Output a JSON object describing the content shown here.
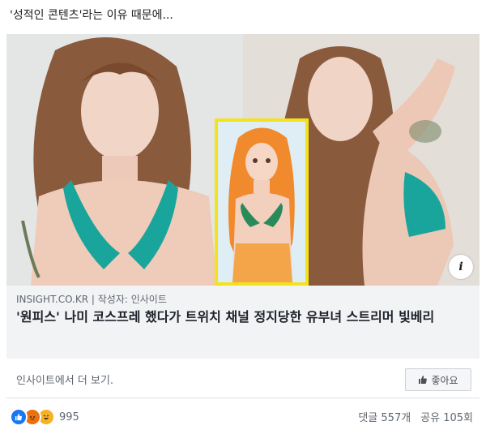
{
  "post": {
    "caption": "'성적인 콘텐츠'라는 이유 때문에..."
  },
  "link": {
    "source": "INSIGHT.CO.KR | 작성자: 인사이트",
    "headline": "'원피스' 나미 코스프레 했다가 트위치 채널 정지당한 유부녀 스트리머 빛베리"
  },
  "footer": {
    "see_more": "인사이트에서 더 보기.",
    "like_page_label": "좋아요"
  },
  "reactions": {
    "count": "995",
    "comments": "댓글 557개",
    "shares": "공유 105회",
    "icons": [
      "like-icon",
      "angry-icon",
      "haha-icon"
    ]
  },
  "colors": {
    "inset_border": "#f3e21c",
    "link_bg": "#f2f3f5",
    "accent": "#1877f2"
  }
}
